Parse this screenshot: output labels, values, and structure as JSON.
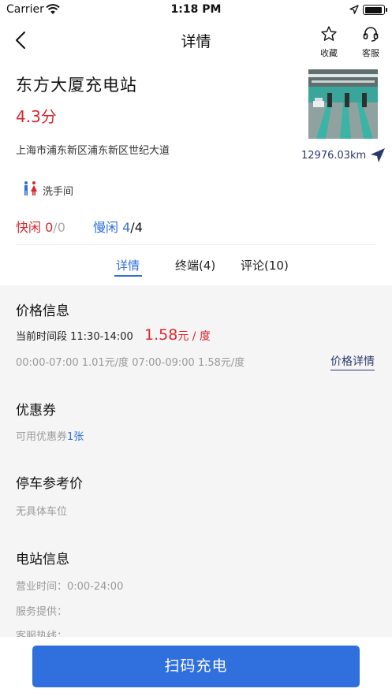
{
  "status_bar": {
    "carrier": "Carrier",
    "time": "1:18 PM",
    "battery_level": 0.95
  },
  "nav": {
    "title": "详情",
    "favorite_label": "收藏",
    "service_label": "客服",
    "icons": {
      "back": "chevron-left-icon",
      "favorite": "star-icon",
      "service": "headset-icon"
    }
  },
  "station": {
    "name": "东方大厦充电站",
    "rating": "4.3分",
    "address": "上海市浦东新区浦东新区世纪大道",
    "distance": "12976.03km",
    "facility": "洗手间"
  },
  "availability": {
    "fast_label": "快闲",
    "fast_free": "0",
    "fast_total": "/0",
    "slow_label": "慢闲",
    "slow_free": "4",
    "slow_total": "/4"
  },
  "tabs": [
    {
      "label": "详情",
      "active": true
    },
    {
      "label": "终端(4)",
      "active": false
    },
    {
      "label": "评论(10)",
      "active": false
    }
  ],
  "price_section": {
    "title": "价格信息",
    "current_period_label": "当前时间段 11:30-14:00",
    "current_price": "1.58",
    "price_unit": "元 / 度",
    "schedule": "00:00-07:00 1.01元/度 07:00-09:00 1.58元/度",
    "detail_link": "价格详情"
  },
  "coupon_section": {
    "title": "优惠券",
    "available_label": "可用优惠券",
    "available_count": "1张"
  },
  "parking_section": {
    "title": "停车参考价",
    "value": "无具体车位"
  },
  "station_info": {
    "title": "电站信息",
    "hours": "营业时间：0:00-24:00",
    "provider": "服务提供：",
    "hotline": "客服热线："
  },
  "action": {
    "scan_charge_label": "扫码充电"
  },
  "colors": {
    "accent": "#2f6fde",
    "price_red": "#d9272e",
    "nav_dark": "#2b3a6e",
    "content_bg": "#f5f5f5"
  }
}
